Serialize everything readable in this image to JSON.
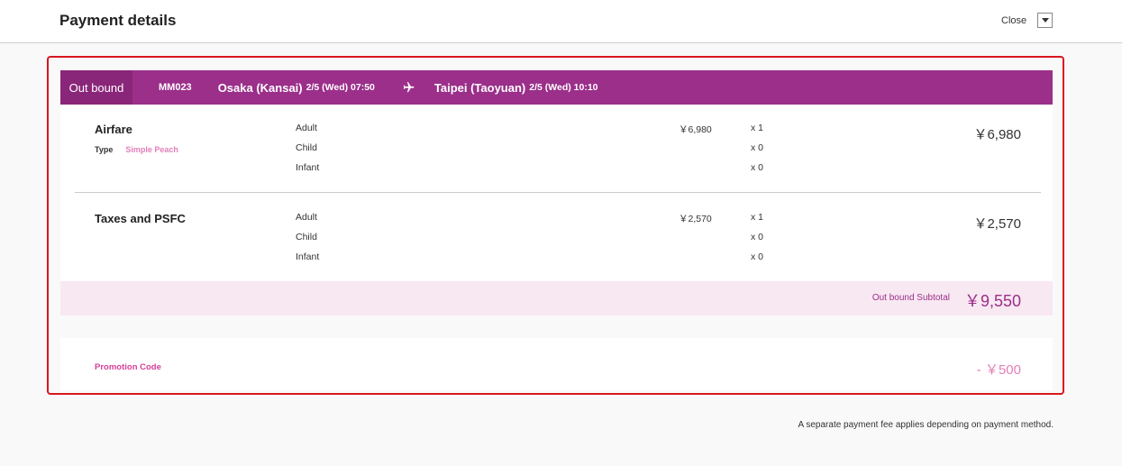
{
  "header": {
    "title": "Payment details",
    "close_label": "Close"
  },
  "flight": {
    "direction": "Out bound",
    "flight_no": "MM023",
    "from_city": "Osaka (Kansai)",
    "from_time": "2/5 (Wed) 07:50",
    "to_city": "Taipei (Taoyuan)",
    "to_time": "2/5 (Wed) 10:10"
  },
  "airfare": {
    "title": "Airfare",
    "type_label": "Type",
    "type_value": "Simple Peach",
    "rows": [
      {
        "pax": "Adult",
        "unit": "￥6,980",
        "qty": "x 1"
      },
      {
        "pax": "Child",
        "unit": "",
        "qty": "x 0"
      },
      {
        "pax": "Infant",
        "unit": "",
        "qty": "x 0"
      }
    ],
    "total": "￥6,980"
  },
  "taxes": {
    "title": "Taxes and PSFC",
    "rows": [
      {
        "pax": "Adult",
        "unit": "￥2,570",
        "qty": "x 1"
      },
      {
        "pax": "Child",
        "unit": "",
        "qty": "x 0"
      },
      {
        "pax": "Infant",
        "unit": "",
        "qty": "x 0"
      }
    ],
    "total": "￥2,570"
  },
  "subtotal": {
    "label": "Out bound Subtotal",
    "value": "￥9,550"
  },
  "promo": {
    "label": "Promotion Code",
    "value": "- ￥500"
  },
  "footer": {
    "note": "A separate payment fee applies depending on payment method."
  },
  "colors": {
    "brand": "#9b2f8a",
    "brand_dark": "#8a2679",
    "highlight": "#d9171e",
    "pink": "#e37fb8",
    "band": "#f8e8f2"
  },
  "icons": {
    "plane": "airplane-icon",
    "close": "chevron-down-icon"
  }
}
